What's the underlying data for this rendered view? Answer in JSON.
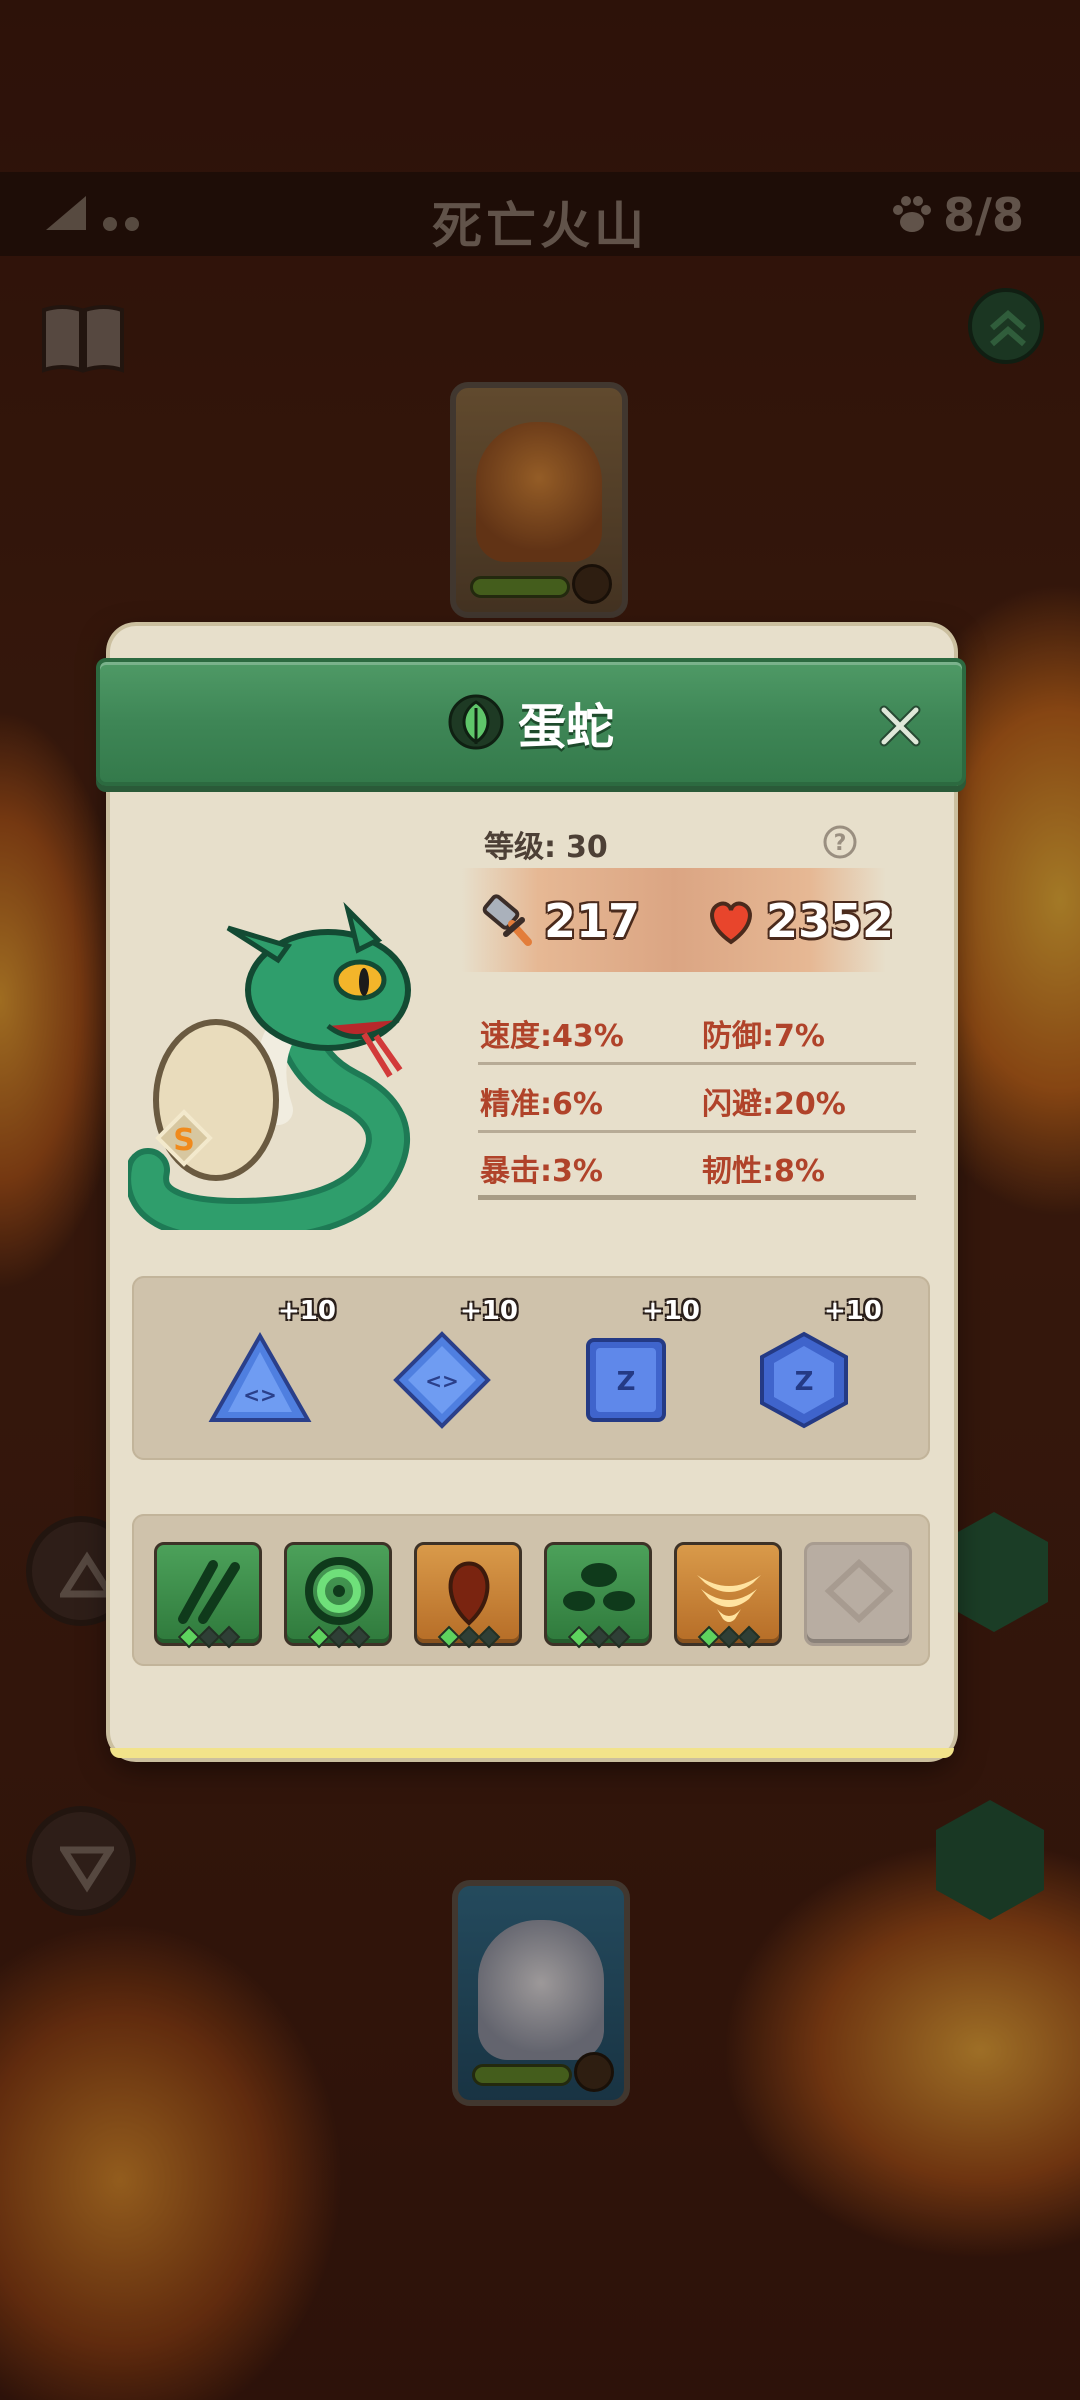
{
  "map": {
    "title": "死亡火山",
    "team_count": "8/8"
  },
  "creature": {
    "name": "蛋蛇",
    "element_icon": "leaf-icon",
    "grade": "S",
    "level_label": "等级:",
    "level_value": "30",
    "attack": "217",
    "hp": "2352"
  },
  "attributes": [
    {
      "left": "速度:43%",
      "right": "防御:7%"
    },
    {
      "left": "精准:6%",
      "right": "闪避:20%"
    },
    {
      "left": "暴击:3%",
      "right": "韧性:8%"
    }
  ],
  "gems": [
    {
      "shape": "triangle-gem-icon",
      "level": "+10"
    },
    {
      "shape": "diamond-gem-icon",
      "level": "+10"
    },
    {
      "shape": "square-gem-icon",
      "level": "+10"
    },
    {
      "shape": "hexagon-gem-icon",
      "level": "+10"
    }
  ],
  "skills": [
    {
      "icon": "claw-slash-icon",
      "color": "green",
      "stars": 1
    },
    {
      "icon": "spiral-icon",
      "color": "green",
      "stars": 1
    },
    {
      "icon": "drop-icon",
      "color": "orange",
      "stars": 1
    },
    {
      "icon": "leaves-icon",
      "color": "green",
      "stars": 1
    },
    {
      "icon": "shield-stack-icon",
      "color": "orange",
      "stars": 1
    },
    {
      "icon": "empty-slot-icon",
      "color": "empty",
      "stars": 0
    }
  ],
  "colors": {
    "header_green": "#3e8656",
    "modal_bg": "#e7dfcb",
    "attribute_text": "#b0432a",
    "panel_bg": "#cfc2ab"
  }
}
